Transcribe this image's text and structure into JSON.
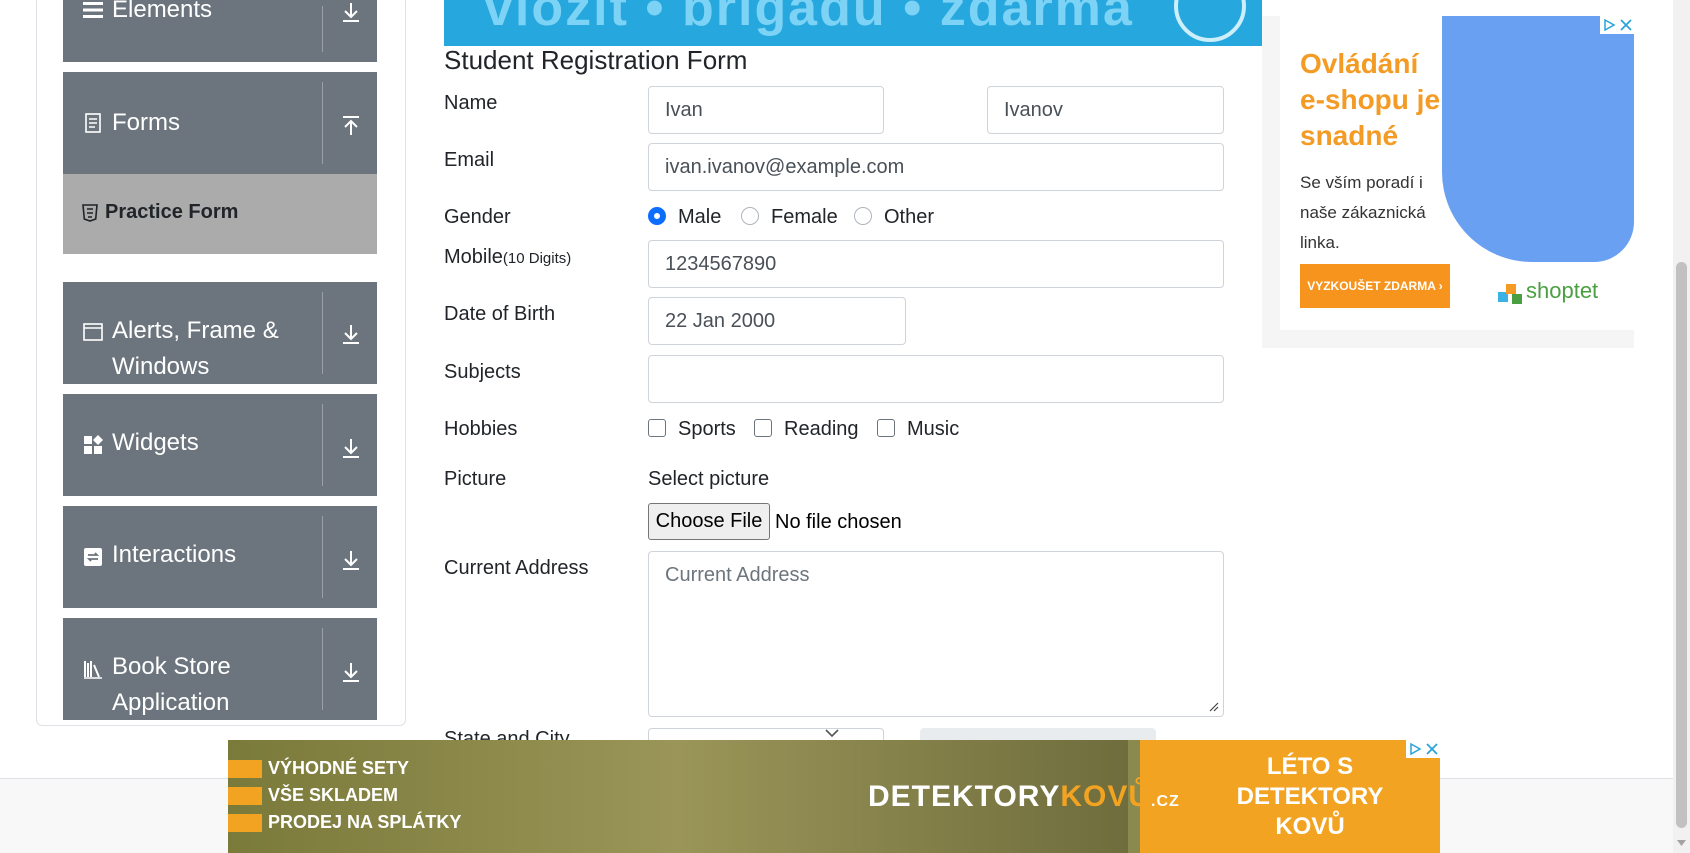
{
  "sidebar": {
    "groups": [
      {
        "label": "Elements",
        "icon": "hamburger-icon",
        "arrow": "down-arrow-icon"
      },
      {
        "label": "Forms",
        "icon": "document-icon",
        "arrow": "up-arrow-icon"
      },
      {
        "label": "Alerts, Frame & Windows",
        "icon": "window-icon",
        "arrow": "down-arrow-icon"
      },
      {
        "label": "Widgets",
        "icon": "widgets-icon",
        "arrow": "down-arrow-icon"
      },
      {
        "label": "Interactions",
        "icon": "interactions-icon",
        "arrow": "down-arrow-icon"
      },
      {
        "label": "Book Store Application",
        "icon": "books-icon",
        "arrow": "down-arrow-icon"
      }
    ],
    "active_item": {
      "label": "Practice Form",
      "icon": "html5-icon"
    }
  },
  "top_banner": {
    "text": "vložit • brigádu • zdarma"
  },
  "form": {
    "title": "Student Registration Form",
    "labels": {
      "name": "Name",
      "email": "Email",
      "gender": "Gender",
      "mobile": "Mobile",
      "mobile_hint": "(10 Digits)",
      "dob": "Date of Birth",
      "subjects": "Subjects",
      "hobbies": "Hobbies",
      "picture": "Picture",
      "address": "Current Address",
      "state_city": "State and City"
    },
    "first_name": "Ivan",
    "last_name": "Ivanov",
    "email": "ivan.ivanov@example.com",
    "gender_options": [
      "Male",
      "Female",
      "Other"
    ],
    "gender_selected": "Male",
    "mobile": "1234567890",
    "dob": "22 Jan 2000",
    "subjects": "",
    "hobbies": [
      "Sports",
      "Reading",
      "Music"
    ],
    "picture_label": "Select picture",
    "file_button": "Choose File",
    "file_status": "No file chosen",
    "address_placeholder": "Current Address"
  },
  "ad_right": {
    "headline": "Ovládání e-shopu je snadné",
    "body": "Se vším poradí i naše zákaznická linka.",
    "cta": "VYZKOUŠET ZDARMA ›",
    "brand": "shoptet"
  },
  "ad_bottom": {
    "lines": [
      "VÝHODNÉ SETY",
      "VŠE SKLADEM",
      "PRODEJ NA SPLÁTKY"
    ],
    "logo_a": "DETEKTORY",
    "logo_b": "KOVŮ",
    "logo_c": ".CZ",
    "right_text": "LÉTO S DETEKTORY KOVŮ"
  },
  "colors": {
    "sidebar_group": "#6c757d",
    "sidebar_active": "#ababab",
    "radio_checked": "#0d6efd",
    "banner": "#26a7dd",
    "ad_orange": "#f39b24"
  }
}
